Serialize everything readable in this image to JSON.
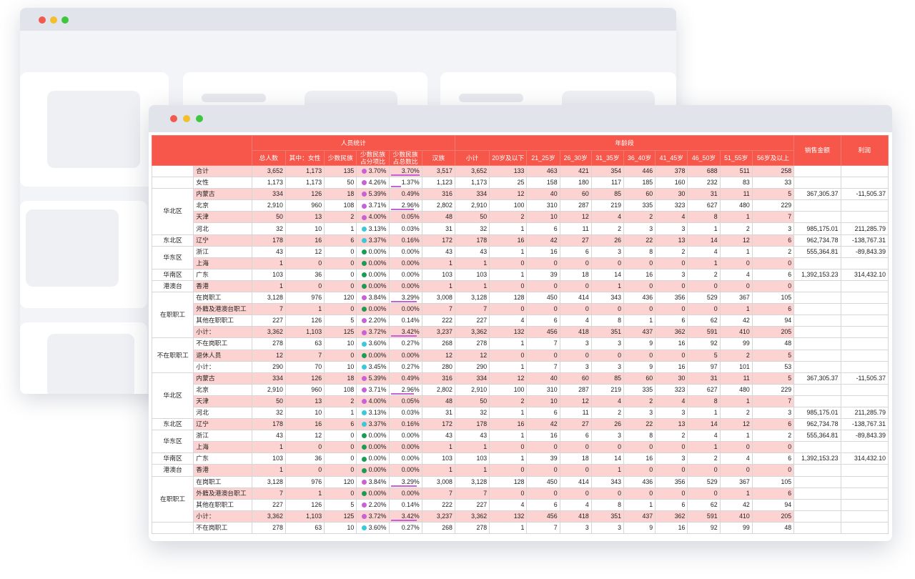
{
  "colors": {
    "header_bg": "#f7574a",
    "row_pink": "#fcd3d1",
    "icon_purple": "#c860d8",
    "icon_cyan": "#3cc8dc",
    "icon_green": "#1a9c55"
  },
  "header": {
    "group1": "人员统计",
    "group2": "年龄段",
    "sales": "销售金额",
    "profit": "利润",
    "cols1": [
      "总人数",
      "其中：女性",
      "少数民族",
      "少数民族占分项比",
      "少数民族占总数比",
      "汉族"
    ],
    "cols2": [
      "小计",
      "20岁及以下",
      "21_25岁",
      "26_30岁",
      "31_35岁",
      "36_40岁",
      "41_45岁",
      "46_50岁",
      "51_55岁",
      "56岁及以上"
    ]
  },
  "rows": [
    {
      "region": "",
      "label": "合计",
      "v": [
        "3,652",
        "1,173",
        "135"
      ],
      "icon": "purple",
      "pct1": "3.70%",
      "pct2": "3.70%",
      "bar": 1.0,
      "han": "3,517",
      "ages": [
        "3,652",
        "133",
        "463",
        "421",
        "354",
        "446",
        "378",
        "688",
        "511",
        "258"
      ],
      "sales": "",
      "profit": ""
    },
    {
      "region": "",
      "label": "女性",
      "v": [
        "1,173",
        "1,173",
        "50"
      ],
      "icon": "purple",
      "pct1": "4.26%",
      "pct2": "1.37%",
      "bar": 0.37,
      "han": "1,123",
      "ages": [
        "1,173",
        "25",
        "158",
        "180",
        "117",
        "185",
        "160",
        "232",
        "83",
        "33"
      ],
      "sales": "",
      "profit": ""
    },
    {
      "region": "华北区",
      "span": 4,
      "label": "内蒙古",
      "v": [
        "334",
        "126",
        "18"
      ],
      "icon": "purple",
      "pct1": "5.39%",
      "pct2": "0.49%",
      "bar": 0,
      "han": "316",
      "ages": [
        "334",
        "12",
        "40",
        "60",
        "85",
        "60",
        "30",
        "31",
        "11",
        "5"
      ],
      "sales": "367,305.37",
      "profit": "-11,505.37"
    },
    {
      "region": "",
      "label": "北京",
      "v": [
        "2,910",
        "960",
        "108"
      ],
      "icon": "purple",
      "pct1": "3.71%",
      "pct2": "2.96%",
      "bar": 0.8,
      "han": "2,802",
      "ages": [
        "2,910",
        "100",
        "310",
        "287",
        "219",
        "335",
        "323",
        "627",
        "480",
        "229"
      ],
      "sales": "",
      "profit": ""
    },
    {
      "region": "",
      "label": "天津",
      "v": [
        "50",
        "13",
        "2"
      ],
      "icon": "purple",
      "pct1": "4.00%",
      "pct2": "0.05%",
      "bar": 0,
      "han": "48",
      "ages": [
        "50",
        "2",
        "10",
        "12",
        "4",
        "2",
        "4",
        "8",
        "1",
        "7"
      ],
      "sales": "",
      "profit": ""
    },
    {
      "region": "",
      "label": "河北",
      "v": [
        "32",
        "10",
        "1"
      ],
      "icon": "cyan",
      "pct1": "3.13%",
      "pct2": "0.03%",
      "bar": 0,
      "han": "31",
      "ages": [
        "32",
        "1",
        "6",
        "11",
        "2",
        "3",
        "3",
        "1",
        "2",
        "3"
      ],
      "sales": "985,175.01",
      "profit": "211,285.79"
    },
    {
      "region": "东北区",
      "span": 1,
      "label": "辽宁",
      "v": [
        "178",
        "16",
        "6"
      ],
      "icon": "cyan",
      "pct1": "3.37%",
      "pct2": "0.16%",
      "bar": 0,
      "han": "172",
      "ages": [
        "178",
        "16",
        "42",
        "27",
        "26",
        "22",
        "13",
        "14",
        "12",
        "6"
      ],
      "sales": "962,734.78",
      "profit": "-138,767.31"
    },
    {
      "region": "华东区",
      "span": 2,
      "label": "浙江",
      "v": [
        "43",
        "12",
        "0"
      ],
      "icon": "green",
      "pct1": "0.00%",
      "pct2": "0.00%",
      "bar": 0,
      "han": "43",
      "ages": [
        "43",
        "1",
        "16",
        "6",
        "3",
        "8",
        "2",
        "4",
        "1",
        "2"
      ],
      "sales": "555,364.81",
      "profit": "-89,843.39"
    },
    {
      "region": "",
      "label": "上海",
      "v": [
        "1",
        "0",
        "0"
      ],
      "icon": "green",
      "pct1": "0.00%",
      "pct2": "0.00%",
      "bar": 0,
      "han": "1",
      "ages": [
        "1",
        "0",
        "0",
        "0",
        "0",
        "0",
        "0",
        "1",
        "0",
        "0"
      ],
      "sales": "",
      "profit": ""
    },
    {
      "region": "华南区",
      "span": 1,
      "label": "广东",
      "v": [
        "103",
        "36",
        "0"
      ],
      "icon": "green",
      "pct1": "0.00%",
      "pct2": "0.00%",
      "bar": 0,
      "han": "103",
      "ages": [
        "103",
        "1",
        "39",
        "18",
        "14",
        "16",
        "3",
        "2",
        "4",
        "6"
      ],
      "sales": "1,392,153.23",
      "profit": "314,432.10"
    },
    {
      "region": "港澳台",
      "span": 1,
      "label": "香港",
      "v": [
        "1",
        "0",
        "0"
      ],
      "icon": "green",
      "pct1": "0.00%",
      "pct2": "0.00%",
      "bar": 0,
      "han": "1",
      "ages": [
        "1",
        "0",
        "0",
        "0",
        "1",
        "0",
        "0",
        "0",
        "0",
        "0"
      ],
      "sales": "",
      "profit": ""
    },
    {
      "region": "在职职工",
      "span": 4,
      "label": "在岗职工",
      "v": [
        "3,128",
        "976",
        "120"
      ],
      "icon": "purple",
      "pct1": "3.84%",
      "pct2": "3.29%",
      "bar": 0.9,
      "han": "3,008",
      "ages": [
        "3,128",
        "128",
        "450",
        "414",
        "343",
        "436",
        "356",
        "529",
        "367",
        "105"
      ],
      "sales": "",
      "profit": ""
    },
    {
      "region": "",
      "label": "外籍及港澳台职工",
      "v": [
        "7",
        "1",
        "0"
      ],
      "icon": "green",
      "pct1": "0.00%",
      "pct2": "0.00%",
      "bar": 0,
      "han": "7",
      "ages": [
        "7",
        "0",
        "0",
        "0",
        "0",
        "0",
        "0",
        "0",
        "1",
        "6"
      ],
      "sales": "",
      "profit": ""
    },
    {
      "region": "",
      "label": "其他在职职工",
      "v": [
        "227",
        "126",
        "5"
      ],
      "icon": "purple",
      "pct1": "2.20%",
      "pct2": "0.14%",
      "bar": 0,
      "han": "222",
      "ages": [
        "227",
        "4",
        "6",
        "4",
        "8",
        "1",
        "6",
        "62",
        "42",
        "94"
      ],
      "sales": "",
      "profit": ""
    },
    {
      "region": "",
      "label": "小计：",
      "v": [
        "3,362",
        "1,103",
        "125"
      ],
      "icon": "purple",
      "pct1": "3.72%",
      "pct2": "3.42%",
      "bar": 0.92,
      "han": "3,237",
      "ages": [
        "3,362",
        "132",
        "456",
        "418",
        "351",
        "437",
        "362",
        "591",
        "410",
        "205"
      ],
      "sales": "",
      "profit": ""
    },
    {
      "region": "不在职职工",
      "span": 3,
      "label": "不在岗职工",
      "v": [
        "278",
        "63",
        "10"
      ],
      "icon": "cyan",
      "pct1": "3.60%",
      "pct2": "0.27%",
      "bar": 0,
      "han": "268",
      "ages": [
        "278",
        "1",
        "7",
        "3",
        "3",
        "9",
        "16",
        "92",
        "99",
        "48"
      ],
      "sales": "",
      "profit": ""
    },
    {
      "region": "",
      "label": "退休人员",
      "v": [
        "12",
        "7",
        "0"
      ],
      "icon": "green",
      "pct1": "0.00%",
      "pct2": "0.00%",
      "bar": 0,
      "han": "12",
      "ages": [
        "12",
        "0",
        "0",
        "0",
        "0",
        "0",
        "0",
        "5",
        "2",
        "5"
      ],
      "sales": "",
      "profit": ""
    },
    {
      "region": "",
      "label": "小计：",
      "v": [
        "290",
        "70",
        "10"
      ],
      "icon": "cyan",
      "pct1": "3.45%",
      "pct2": "0.27%",
      "bar": 0,
      "han": "280",
      "ages": [
        "290",
        "1",
        "7",
        "3",
        "3",
        "9",
        "16",
        "97",
        "101",
        "53"
      ],
      "sales": "",
      "profit": ""
    },
    {
      "region": "华北区",
      "span": 4,
      "label": "内蒙古",
      "v": [
        "334",
        "126",
        "18"
      ],
      "icon": "purple",
      "pct1": "5.39%",
      "pct2": "0.49%",
      "bar": 0,
      "han": "316",
      "ages": [
        "334",
        "12",
        "40",
        "60",
        "85",
        "60",
        "30",
        "31",
        "11",
        "5"
      ],
      "sales": "367,305.37",
      "profit": "-11,505.37"
    },
    {
      "region": "",
      "label": "北京",
      "v": [
        "2,910",
        "960",
        "108"
      ],
      "icon": "purple",
      "pct1": "3.71%",
      "pct2": "2.96%",
      "bar": 0.8,
      "han": "2,802",
      "ages": [
        "2,910",
        "100",
        "310",
        "287",
        "219",
        "335",
        "323",
        "627",
        "480",
        "229"
      ],
      "sales": "",
      "profit": ""
    },
    {
      "region": "",
      "label": "天津",
      "v": [
        "50",
        "13",
        "2"
      ],
      "icon": "purple",
      "pct1": "4.00%",
      "pct2": "0.05%",
      "bar": 0,
      "han": "48",
      "ages": [
        "50",
        "2",
        "10",
        "12",
        "4",
        "2",
        "4",
        "8",
        "1",
        "7"
      ],
      "sales": "",
      "profit": ""
    },
    {
      "region": "",
      "label": "河北",
      "v": [
        "32",
        "10",
        "1"
      ],
      "icon": "cyan",
      "pct1": "3.13%",
      "pct2": "0.03%",
      "bar": 0,
      "han": "31",
      "ages": [
        "32",
        "1",
        "6",
        "11",
        "2",
        "3",
        "3",
        "1",
        "2",
        "3"
      ],
      "sales": "985,175.01",
      "profit": "211,285.79"
    },
    {
      "region": "东北区",
      "span": 1,
      "label": "辽宁",
      "v": [
        "178",
        "16",
        "6"
      ],
      "icon": "cyan",
      "pct1": "3.37%",
      "pct2": "0.16%",
      "bar": 0,
      "han": "172",
      "ages": [
        "178",
        "16",
        "42",
        "27",
        "26",
        "22",
        "13",
        "14",
        "12",
        "6"
      ],
      "sales": "962,734.78",
      "profit": "-138,767.31"
    },
    {
      "region": "华东区",
      "span": 2,
      "label": "浙江",
      "v": [
        "43",
        "12",
        "0"
      ],
      "icon": "green",
      "pct1": "0.00%",
      "pct2": "0.00%",
      "bar": 0,
      "han": "43",
      "ages": [
        "43",
        "1",
        "16",
        "6",
        "3",
        "8",
        "2",
        "4",
        "1",
        "2"
      ],
      "sales": "555,364.81",
      "profit": "-89,843.39"
    },
    {
      "region": "",
      "label": "上海",
      "v": [
        "1",
        "0",
        "0"
      ],
      "icon": "green",
      "pct1": "0.00%",
      "pct2": "0.00%",
      "bar": 0,
      "han": "1",
      "ages": [
        "1",
        "0",
        "0",
        "0",
        "0",
        "0",
        "0",
        "1",
        "0",
        "0"
      ],
      "sales": "",
      "profit": ""
    },
    {
      "region": "华南区",
      "span": 1,
      "label": "广东",
      "v": [
        "103",
        "36",
        "0"
      ],
      "icon": "green",
      "pct1": "0.00%",
      "pct2": "0.00%",
      "bar": 0,
      "han": "103",
      "ages": [
        "103",
        "1",
        "39",
        "18",
        "14",
        "16",
        "3",
        "2",
        "4",
        "6"
      ],
      "sales": "1,392,153.23",
      "profit": "314,432.10"
    },
    {
      "region": "港澳台",
      "span": 1,
      "label": "香港",
      "v": [
        "1",
        "0",
        "0"
      ],
      "icon": "green",
      "pct1": "0.00%",
      "pct2": "0.00%",
      "bar": 0,
      "han": "1",
      "ages": [
        "1",
        "0",
        "0",
        "0",
        "1",
        "0",
        "0",
        "0",
        "0",
        "0"
      ],
      "sales": "",
      "profit": ""
    },
    {
      "region": "在职职工",
      "span": 4,
      "label": "在岗职工",
      "v": [
        "3,128",
        "976",
        "120"
      ],
      "icon": "purple",
      "pct1": "3.84%",
      "pct2": "3.29%",
      "bar": 0.9,
      "han": "3,008",
      "ages": [
        "3,128",
        "128",
        "450",
        "414",
        "343",
        "436",
        "356",
        "529",
        "367",
        "105"
      ],
      "sales": "",
      "profit": ""
    },
    {
      "region": "",
      "label": "外籍及港澳台职工",
      "v": [
        "7",
        "1",
        "0"
      ],
      "icon": "green",
      "pct1": "0.00%",
      "pct2": "0.00%",
      "bar": 0,
      "han": "7",
      "ages": [
        "7",
        "0",
        "0",
        "0",
        "0",
        "0",
        "0",
        "0",
        "1",
        "6"
      ],
      "sales": "",
      "profit": ""
    },
    {
      "region": "",
      "label": "其他在职职工",
      "v": [
        "227",
        "126",
        "5"
      ],
      "icon": "purple",
      "pct1": "2.20%",
      "pct2": "0.14%",
      "bar": 0,
      "han": "222",
      "ages": [
        "227",
        "4",
        "6",
        "4",
        "8",
        "1",
        "6",
        "62",
        "42",
        "94"
      ],
      "sales": "",
      "profit": ""
    },
    {
      "region": "",
      "label": "小计：",
      "v": [
        "3,362",
        "1,103",
        "125"
      ],
      "icon": "purple",
      "pct1": "3.72%",
      "pct2": "3.42%",
      "bar": 0.92,
      "han": "3,237",
      "ages": [
        "3,362",
        "132",
        "456",
        "418",
        "351",
        "437",
        "362",
        "591",
        "410",
        "205"
      ],
      "sales": "",
      "profit": ""
    },
    {
      "region": "",
      "span": 1,
      "label": "不在岗职工",
      "v": [
        "278",
        "63",
        "10"
      ],
      "icon": "cyan",
      "pct1": "3.60%",
      "pct2": "0.27%",
      "bar": 0,
      "han": "268",
      "ages": [
        "278",
        "1",
        "7",
        "3",
        "3",
        "9",
        "16",
        "92",
        "99",
        "48"
      ],
      "sales": "",
      "profit": ""
    }
  ]
}
